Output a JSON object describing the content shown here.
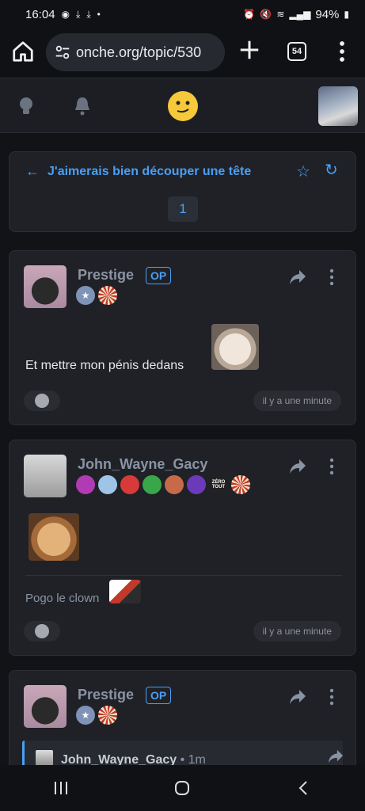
{
  "status": {
    "time": "16:04",
    "battery": "94%",
    "dot": "•"
  },
  "browser": {
    "url": "onche.org/topic/530",
    "tab_count": "54"
  },
  "topic": {
    "title": "J'aimerais bien découper une tête",
    "page": "1"
  },
  "posts": [
    {
      "username": "Prestige",
      "op": "OP",
      "text": "Et mettre mon pénis dedans",
      "time": "il y a une minute"
    },
    {
      "username": "John_Wayne_Gacy",
      "badge_zero": "ZÉRO TOUT",
      "signature": "Pogo le clown",
      "time": "il y a une minute"
    },
    {
      "username": "Prestige",
      "op": "OP",
      "quote_author": "John_Wayne_Gacy",
      "quote_age": "• 1m"
    }
  ],
  "colors": {
    "accent": "#4a9ff5",
    "card": "#1f2126",
    "bg": "#121317"
  }
}
